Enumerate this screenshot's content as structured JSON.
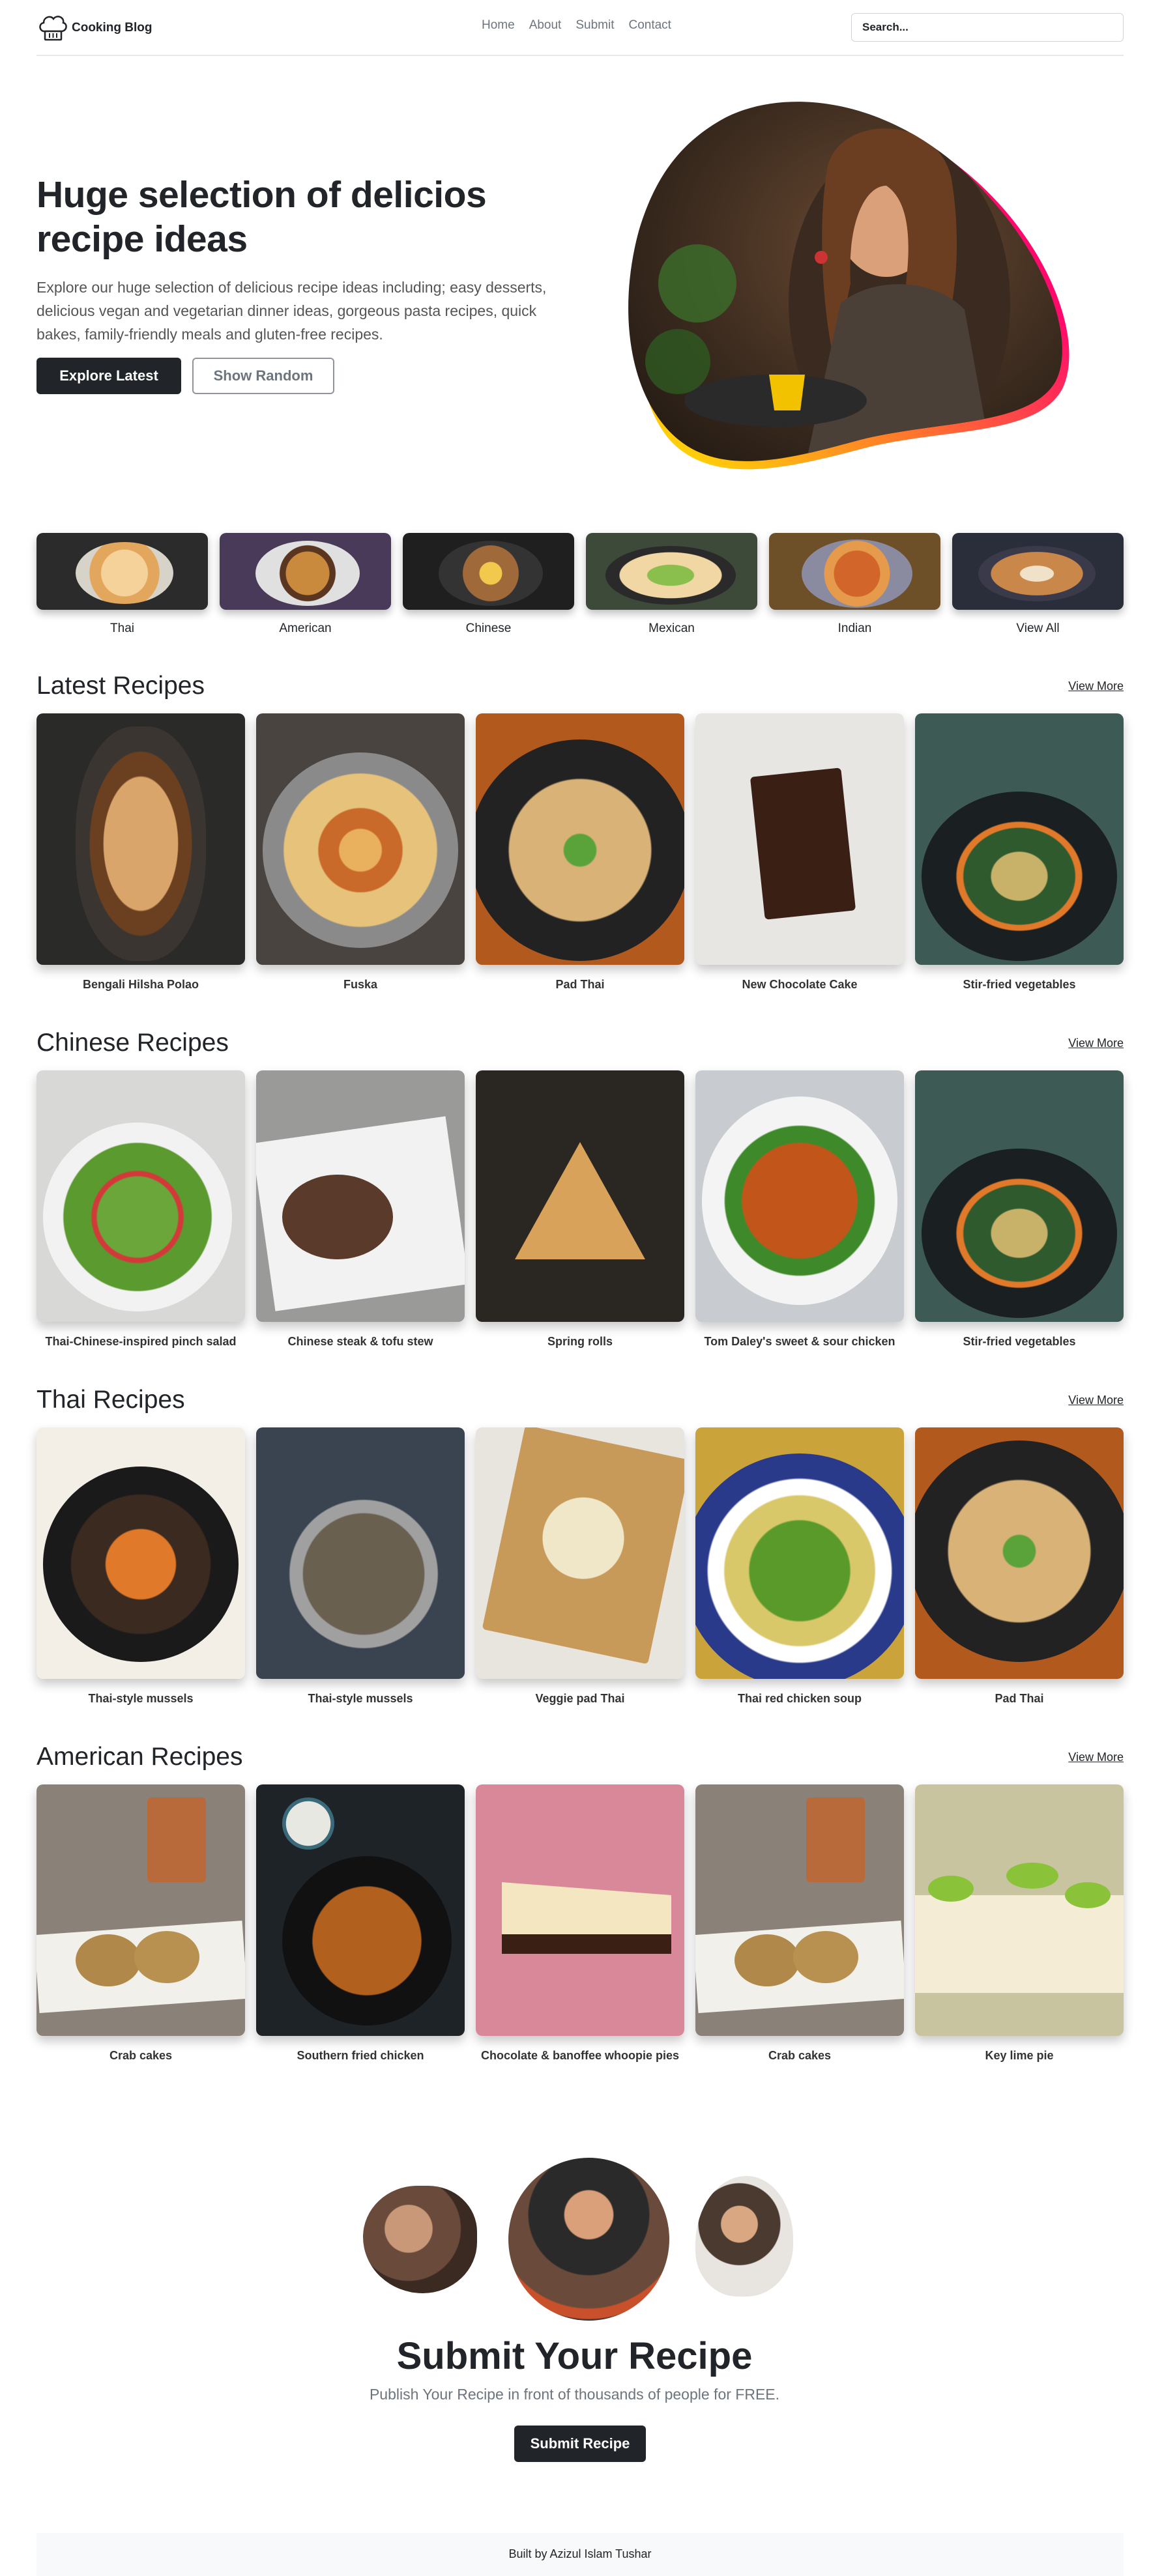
{
  "header": {
    "logo_text": "Cooking Blog",
    "nav": [
      "Home",
      "About",
      "Submit",
      "Contact"
    ],
    "search_placeholder": "Search..."
  },
  "hero": {
    "title": "Huge selection of delicios recipe ideas",
    "text": "Explore our huge selection of delicious recipe ideas including; easy desserts, delicious vegan and vegetarian dinner ideas, gorgeous pasta recipes, quick bakes, family-friendly meals and gluten-free recipes.",
    "btn_primary": "Explore Latest",
    "btn_secondary": "Show Random"
  },
  "categories": [
    "Thai",
    "American",
    "Chinese",
    "Mexican",
    "Indian",
    "View All"
  ],
  "sections": [
    {
      "title": "Latest Recipes",
      "view_more": "View More",
      "items": [
        "Bengali Hilsha Polao",
        "Fuska",
        "Pad Thai",
        "New Chocolate Cake",
        "Stir-fried vegetables"
      ]
    },
    {
      "title": "Chinese Recipes",
      "view_more": "View More",
      "items": [
        "Thai-Chinese-inspired pinch salad",
        "Chinese steak & tofu stew",
        "Spring rolls",
        "Tom Daley's sweet & sour chicken",
        "Stir-fried vegetables"
      ]
    },
    {
      "title": "Thai Recipes",
      "view_more": "View More",
      "items": [
        "Thai-style mussels",
        "Thai-style mussels",
        "Veggie pad Thai",
        "Thai red chicken soup",
        "Pad Thai"
      ]
    },
    {
      "title": "American Recipes",
      "view_more": "View More",
      "items": [
        "Crab cakes",
        "Southern fried chicken",
        "Chocolate & banoffee whoopie pies",
        "Crab cakes",
        "Key lime pie"
      ]
    }
  ],
  "submit": {
    "title": "Submit Your Recipe",
    "text": "Publish Your Recipe in front of thousands of people for FREE.",
    "button": "Submit Recipe"
  },
  "footer": {
    "text": "Built by Azizul Islam Tushar"
  },
  "colors": {
    "dark": "#212529",
    "blob_pink": "#ff0a6c",
    "blob_yellow": "#ffe600"
  }
}
